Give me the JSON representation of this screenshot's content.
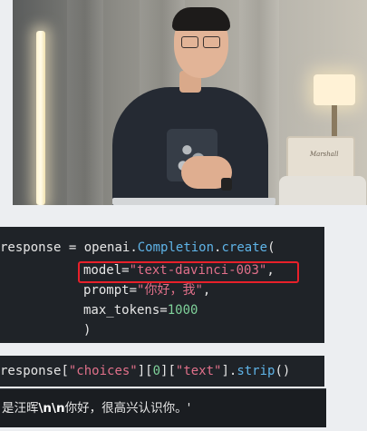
{
  "video": {
    "speaker_brand": "Marshall"
  },
  "code_cell": {
    "line1": {
      "var": "response",
      "eq": " = ",
      "module": "openai",
      "dot1": ".",
      "cls": "Completion",
      "dot2": ".",
      "fn": "create",
      "paren": "("
    },
    "line2": {
      "key": "model",
      "eq": "=",
      "val": "\"text-davinci-003\"",
      "comma": ","
    },
    "line3": {
      "key": "prompt",
      "eq": "=",
      "val": "\"你好，我\"",
      "comma": ","
    },
    "line4": {
      "key": "max_tokens",
      "eq": "=",
      "val": "1000"
    },
    "line5": {
      "paren": ")"
    }
  },
  "output_cell": {
    "var": "response",
    "b1": "[",
    "s1": "\"choices\"",
    "b2": "][",
    "n1": "0",
    "b3": "][",
    "s2": "\"text\"",
    "b4": "].",
    "fn": "strip",
    "call": "()"
  },
  "result_cell": {
    "prefix": "是汪晖",
    "escape": "\\n\\n",
    "suffix": "你好，很高兴认识你。'"
  },
  "colors": {
    "highlight_box": "#e8202a",
    "string": "#e0708a",
    "class": "#5fb4e8",
    "number": "#7fd19a"
  }
}
